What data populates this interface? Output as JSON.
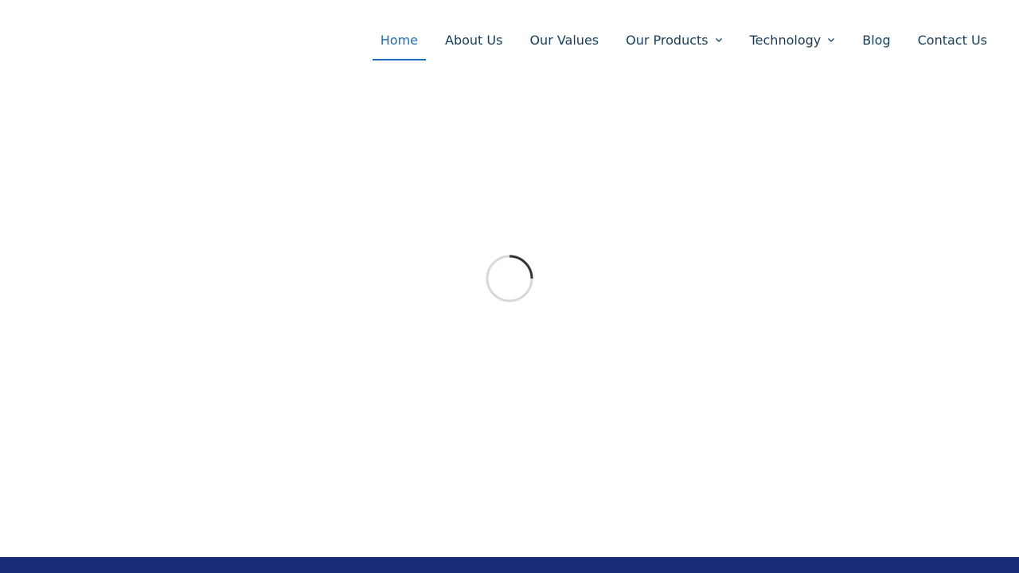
{
  "nav": {
    "items": [
      {
        "label": "Home",
        "active": true,
        "has_dropdown": false
      },
      {
        "label": "About Us",
        "active": false,
        "has_dropdown": false
      },
      {
        "label": "Our Values",
        "active": false,
        "has_dropdown": false
      },
      {
        "label": "Our Products",
        "active": false,
        "has_dropdown": true
      },
      {
        "label": "Technology",
        "active": false,
        "has_dropdown": true
      },
      {
        "label": "Blog",
        "active": false,
        "has_dropdown": false
      },
      {
        "label": "Contact Us",
        "active": false,
        "has_dropdown": false
      }
    ]
  },
  "loader": {
    "icon": "loading-spinner-icon"
  },
  "colors": {
    "nav_text": "#163d57",
    "nav_active": "#1d6fb8",
    "footer_bar": "#1a2b78",
    "spinner_track": "#d9d9d9",
    "spinner_arc": "#333333"
  }
}
